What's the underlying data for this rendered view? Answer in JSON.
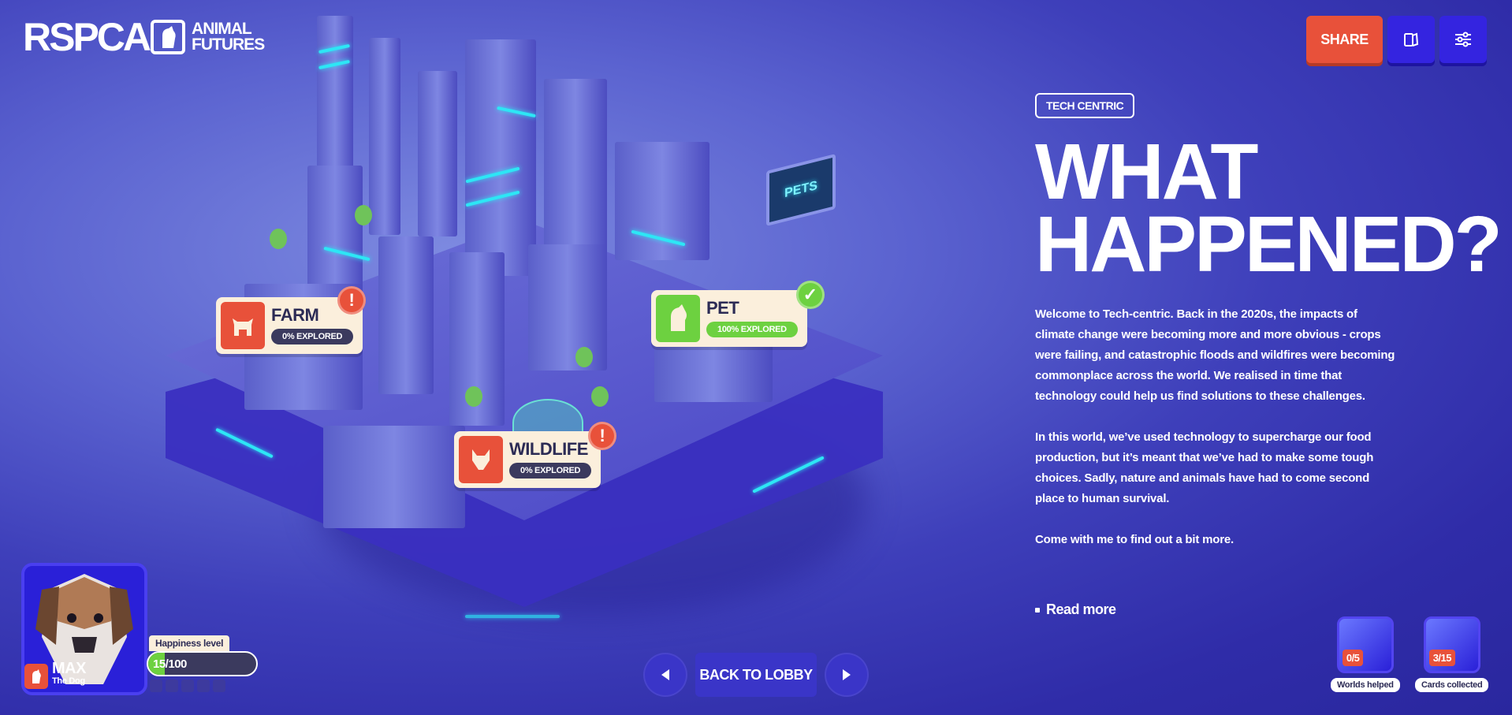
{
  "logo": {
    "main": "RSPCA",
    "sub_line1": "ANIMAL",
    "sub_line2": "FUTURES"
  },
  "top_bar": {
    "share_label": "SHARE"
  },
  "world": {
    "tag": "TECH CENTRIC",
    "headline_line1": "WHAT",
    "headline_line2": "HAPPENED?",
    "paragraphs": [
      "Welcome to Tech-centric. Back in the 2020s, the impacts of climate change were becoming more and more obvious - crops were failing, and catastrophic floods and wildfires were becoming commonplace across the world. We realised in time that technology could help us find solutions to these challenges.",
      "In this world, we’ve used technology to supercharge our food production, but it’s meant that we’ve had to make some tough choices. Sadly, nature and animals have had to come second place to human survival.",
      "Come with me to find out a bit more."
    ],
    "read_more": "Read more"
  },
  "locations": [
    {
      "title": "FARM",
      "status": "0% EXPLORED",
      "badge": "!",
      "color": "#e8513a"
    },
    {
      "title": "PET",
      "status": "100% EXPLORED",
      "badge": "✓",
      "color": "#6dd140"
    },
    {
      "title": "WILDLIFE",
      "status": "0% EXPLORED",
      "badge": "!",
      "color": "#e8513a"
    }
  ],
  "scene": {
    "billboard": "PETS"
  },
  "nav": {
    "lobby_label": "BACK TO LOBBY"
  },
  "character": {
    "name": "MAX",
    "species": "The Dog",
    "happiness_label": "Happiness level",
    "happiness_text": "15/100",
    "happiness_value": 15,
    "happiness_max": 100
  },
  "stats": [
    {
      "count": "0/5",
      "label": "Worlds helped"
    },
    {
      "count": "3/15",
      "label": "Cards collected"
    }
  ],
  "colors": {
    "accent_red": "#e8513a",
    "accent_green": "#6dd140",
    "button_blue": "#3424e0",
    "card_cream": "#fbefdc"
  }
}
